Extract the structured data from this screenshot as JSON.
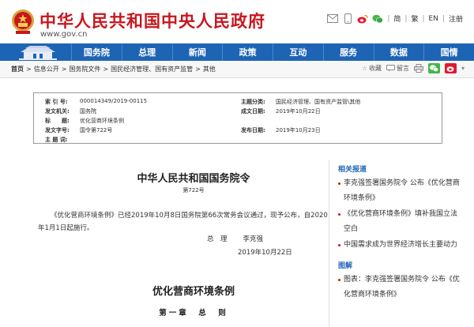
{
  "header": {
    "site_title": "中华人民共和国中央人民政府",
    "site_url": "www.gov.cn",
    "toplinks": [
      "简",
      "繁",
      "EN",
      "注册"
    ]
  },
  "nav": {
    "items": [
      "国务院",
      "总理",
      "新闻",
      "政策",
      "互动",
      "服务",
      "数据",
      "国情"
    ]
  },
  "breadcrumb": {
    "items": [
      "首页",
      "信息公开",
      "国务院文件",
      "国民经济管理、国有资产监管",
      "其他"
    ],
    "separator": ">"
  },
  "tools": {
    "favorite": "收藏",
    "print": "留言"
  },
  "info": {
    "index_label": "索 引 号:",
    "index_value": "000014349/2019-00115",
    "category_label": "主题分类:",
    "category_value": "国民经济管理、国有资产监管\\其他",
    "issuer_label": "发文机关:",
    "issuer_value": "国务院",
    "created_label": "成文日期:",
    "created_value": "2019年10月22日",
    "title_label": "标　　题:",
    "title_value": "优化营商环境条例",
    "docno_label": "发文字号:",
    "docno_value": "国令第722号",
    "published_label": "发布日期:",
    "published_value": "2019年10月23日",
    "keywords_label": "主 题 词:",
    "keywords_value": ""
  },
  "doc": {
    "title": "中华人民共和国国务院令",
    "number": "第722号",
    "paragraph": "《优化营商环境条例》已经2019年10月8日国务院第66次常务会议通过，现予公布，自2020年1月1日起施行。",
    "sign_role": "总　理",
    "sign_name": "李克强",
    "sign_date": "2019年10月22日",
    "law_title": "优化营商环境条例",
    "chapter": "第一章　总　则"
  },
  "sidebar": {
    "related_heading": "相关报道",
    "related": [
      "李克强签署国务院令 公布《优化营商环境条例》",
      "《优化营商环境条例》填补我国立法空白",
      "中国需求成为世界经济增长主要动力"
    ],
    "graphics_heading": "图解",
    "graphics": [
      "图表：李克强签署国务院令 公布《优化营商环境条例》"
    ]
  },
  "colors": {
    "brand_red": "#c8161d",
    "nav_blue": "#1e64b5"
  }
}
